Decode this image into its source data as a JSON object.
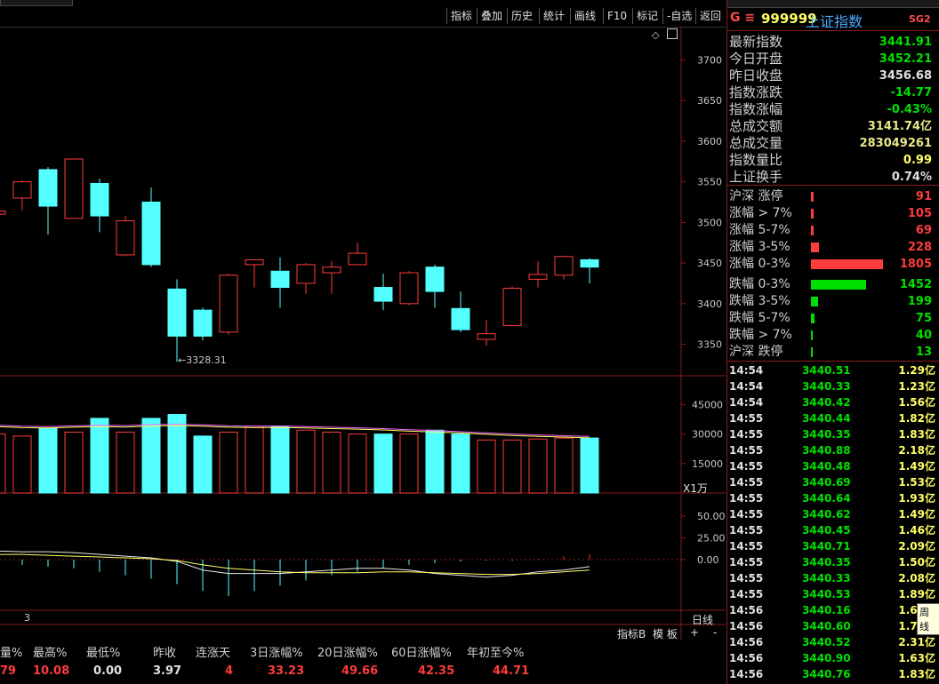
{
  "toolbar": {
    "buttons": [
      "指标",
      "叠加",
      "历史",
      "统计",
      "画线",
      "F10",
      "标记",
      "-自选",
      "返回"
    ]
  },
  "chart": {
    "price_ticks": [
      "3700",
      "3650",
      "3600",
      "3550",
      "3500",
      "3450",
      "3400",
      "3350"
    ],
    "low_annotation": "3328.31",
    "volume_ticks": [
      "45000",
      "30000",
      "15000"
    ],
    "volume_unit": "X1万",
    "macd_ticks": [
      "50.00",
      "25.00",
      "0.00"
    ],
    "period": "日线",
    "bottom_tabs": [
      "指标B",
      "模 板",
      "+",
      "-"
    ],
    "left_num": "3",
    "colors": {
      "up": "#ff3c3c",
      "down": "#54ffff",
      "grid": "#8a1c1c"
    }
  },
  "chart_data": {
    "type": "candlestick",
    "candles": [
      {
        "o": 3510,
        "c": 3514,
        "h": 3516,
        "l": 3508
      },
      {
        "o": 3530,
        "c": 3550,
        "h": 3552,
        "l": 3515
      },
      {
        "o": 3565,
        "c": 3520,
        "h": 3568,
        "l": 3485
      },
      {
        "o": 3505,
        "c": 3578,
        "h": 3578,
        "l": 3505
      },
      {
        "o": 3548,
        "c": 3508,
        "h": 3554,
        "l": 3488
      },
      {
        "o": 3460,
        "c": 3502,
        "h": 3508,
        "l": 3458
      },
      {
        "o": 3525,
        "c": 3448,
        "h": 3543,
        "l": 3445
      },
      {
        "o": 3418,
        "c": 3360,
        "h": 3430,
        "l": 3328.31
      },
      {
        "o": 3392,
        "c": 3360,
        "h": 3395,
        "l": 3355
      },
      {
        "o": 3365,
        "c": 3435,
        "h": 3437,
        "l": 3362
      },
      {
        "o": 3448,
        "c": 3454,
        "h": 3455,
        "l": 3420
      },
      {
        "o": 3440,
        "c": 3420,
        "h": 3457,
        "l": 3395
      },
      {
        "o": 3425,
        "c": 3448,
        "h": 3450,
        "l": 3412
      },
      {
        "o": 3438,
        "c": 3445,
        "h": 3452,
        "l": 3412
      },
      {
        "o": 3448,
        "c": 3462,
        "h": 3475,
        "l": 3448
      },
      {
        "o": 3420,
        "c": 3403,
        "h": 3437,
        "l": 3392
      },
      {
        "o": 3400,
        "c": 3438,
        "h": 3440,
        "l": 3398
      },
      {
        "o": 3445,
        "c": 3415,
        "h": 3448,
        "l": 3395
      },
      {
        "o": 3394,
        "c": 3368,
        "h": 3415,
        "l": 3365
      },
      {
        "o": 3356,
        "c": 3363,
        "h": 3380,
        "l": 3348
      },
      {
        "o": 3373,
        "c": 3419,
        "h": 3421,
        "l": 3372
      },
      {
        "o": 3430,
        "c": 3436,
        "h": 3452,
        "l": 3420
      },
      {
        "o": 3435,
        "c": 3458,
        "h": 3459,
        "l": 3430
      },
      {
        "o": 3454,
        "c": 3445,
        "h": 3456,
        "l": 3425
      }
    ],
    "volumes": [
      30000,
      29000,
      33000,
      31000,
      38000,
      31000,
      38000,
      40000,
      29000,
      31000,
      34000,
      34000,
      32000,
      31000,
      30000,
      30000,
      30000,
      32000,
      30000,
      27000,
      27000,
      27500,
      28000,
      28000
    ],
    "vol_ma": [
      34500,
      34000,
      33800,
      34200,
      34500,
      34300,
      34800,
      35000,
      34700,
      34200,
      34000,
      34100,
      33800,
      33500,
      33200,
      32800,
      32200,
      31800,
      31200,
      30600,
      30000,
      29500,
      29200,
      28800
    ],
    "macd_dif": [
      10,
      9,
      9,
      8,
      6,
      4,
      2,
      -2,
      -12,
      -16,
      -16,
      -16,
      -14,
      -12,
      -10,
      -10,
      -12,
      -16,
      -18,
      -20,
      -18,
      -14,
      -12,
      -8
    ],
    "macd_dea": [
      6,
      6,
      5,
      4,
      3,
      2,
      1,
      -1,
      -6,
      -10,
      -12,
      -14,
      -15,
      -15,
      -15,
      -14,
      -14,
      -15,
      -16,
      -17,
      -17,
      -16,
      -14,
      -12
    ],
    "macd_hist": [
      -2,
      -6,
      -8,
      -10,
      -14,
      -18,
      -22,
      -28,
      -36,
      -42,
      -36,
      -30,
      -24,
      -18,
      -14,
      -10,
      -6,
      -4,
      -2,
      -1,
      -1,
      1,
      4,
      6
    ],
    "price_range": [
      3320,
      3730
    ],
    "volume_range": [
      0,
      52000
    ],
    "macd_range": [
      -60,
      60
    ]
  },
  "panel": {
    "code_label": "G ≡",
    "code": "999999",
    "name": "上证指数",
    "badge": "SG2",
    "rows": [
      {
        "label": "最新指数",
        "value": "3441.91",
        "color": "#00e000"
      },
      {
        "label": "今日开盘",
        "value": "3452.21",
        "color": "#00e000"
      },
      {
        "label": "昨日收盘",
        "value": "3456.68",
        "color": "#e0e0e0"
      },
      {
        "label": "指数涨跌",
        "value": "-14.77",
        "color": "#00e000"
      },
      {
        "label": "指数涨幅",
        "value": "-0.43%",
        "color": "#00e000"
      },
      {
        "label": "总成交额",
        "value": "3141.74亿",
        "color": "#e8e88a"
      },
      {
        "label": "总成交量",
        "value": "283049261",
        "color": "#e8e88a"
      },
      {
        "label": "指数量比",
        "value": "0.99",
        "color": "#ffff66"
      },
      {
        "label": "上证换手",
        "value": "0.74%",
        "color": "#e0e0e0"
      }
    ],
    "breadth": [
      {
        "label": "沪深 涨停",
        "value": "91",
        "pct": 0.02,
        "color": "#ff3c3c"
      },
      {
        "label": "涨幅 > 7%",
        "value": "105",
        "pct": 0.025,
        "color": "#ff3c3c"
      },
      {
        "label": "涨幅 5-7%",
        "value": "69",
        "pct": 0.02,
        "color": "#ff3c3c"
      },
      {
        "label": "涨幅 3-5%",
        "value": "228",
        "pct": 0.07,
        "color": "#ff3c3c"
      },
      {
        "label": "涨幅 0-3%",
        "value": "1805",
        "pct": 0.62,
        "color": "#ff3c3c"
      },
      {
        "label": "跌幅 0-3%",
        "value": "1452",
        "pct": 0.48,
        "color": "#00e000"
      },
      {
        "label": "跌幅 3-5%",
        "value": "199",
        "pct": 0.06,
        "color": "#00e000"
      },
      {
        "label": "跌幅 5-7%",
        "value": "75",
        "pct": 0.03,
        "color": "#00e000"
      },
      {
        "label": "跌幅 > 7%",
        "value": "40",
        "pct": 0.008,
        "color": "#00e000"
      },
      {
        "label": "沪深 跌停",
        "value": "13",
        "pct": 0.004,
        "color": "#00e000"
      }
    ],
    "ticks": [
      {
        "t": "14:54",
        "p": "3440.51",
        "a": "1.29亿"
      },
      {
        "t": "14:54",
        "p": "3440.33",
        "a": "1.23亿"
      },
      {
        "t": "14:54",
        "p": "3440.42",
        "a": "1.56亿"
      },
      {
        "t": "14:55",
        "p": "3440.44",
        "a": "1.82亿"
      },
      {
        "t": "14:55",
        "p": "3440.35",
        "a": "1.83亿"
      },
      {
        "t": "14:55",
        "p": "3440.88",
        "a": "2.18亿"
      },
      {
        "t": "14:55",
        "p": "3440.48",
        "a": "1.49亿"
      },
      {
        "t": "14:55",
        "p": "3440.69",
        "a": "1.53亿"
      },
      {
        "t": "14:55",
        "p": "3440.64",
        "a": "1.93亿"
      },
      {
        "t": "14:55",
        "p": "3440.62",
        "a": "1.49亿"
      },
      {
        "t": "14:55",
        "p": "3440.45",
        "a": "1.46亿"
      },
      {
        "t": "14:55",
        "p": "3440.71",
        "a": "2.09亿"
      },
      {
        "t": "14:55",
        "p": "3440.35",
        "a": "1.50亿"
      },
      {
        "t": "14:55",
        "p": "3440.33",
        "a": "2.08亿"
      },
      {
        "t": "14:55",
        "p": "3440.53",
        "a": "1.89亿"
      },
      {
        "t": "14:56",
        "p": "3440.16",
        "a": "1.64亿"
      },
      {
        "t": "14:56",
        "p": "3440.60",
        "a": "1.70亿"
      },
      {
        "t": "14:56",
        "p": "3440.52",
        "a": "2.31亿"
      },
      {
        "t": "14:56",
        "p": "3440.90",
        "a": "1.63亿"
      },
      {
        "t": "14:56",
        "p": "3440.76",
        "a": "1.83亿"
      }
    ],
    "tooltip": "周线"
  },
  "stats": {
    "headers": [
      "量%",
      "最高%",
      "最低%",
      "昨收",
      "连涨天",
      "3日涨幅%",
      "20日涨幅%",
      "60日涨幅%",
      "年初至今%"
    ],
    "values": [
      "79",
      "10.08",
      "0.00",
      "3.97",
      "4",
      "33.23",
      "49.66",
      "42.35",
      "44.71"
    ],
    "value_colors": [
      "#ff3c3c",
      "#ff3c3c",
      "#e0e0e0",
      "#e0e0e0",
      "#ff3c3c",
      "#ff3c3c",
      "#ff3c3c",
      "#ff3c3c",
      "#ff3c3c"
    ]
  }
}
